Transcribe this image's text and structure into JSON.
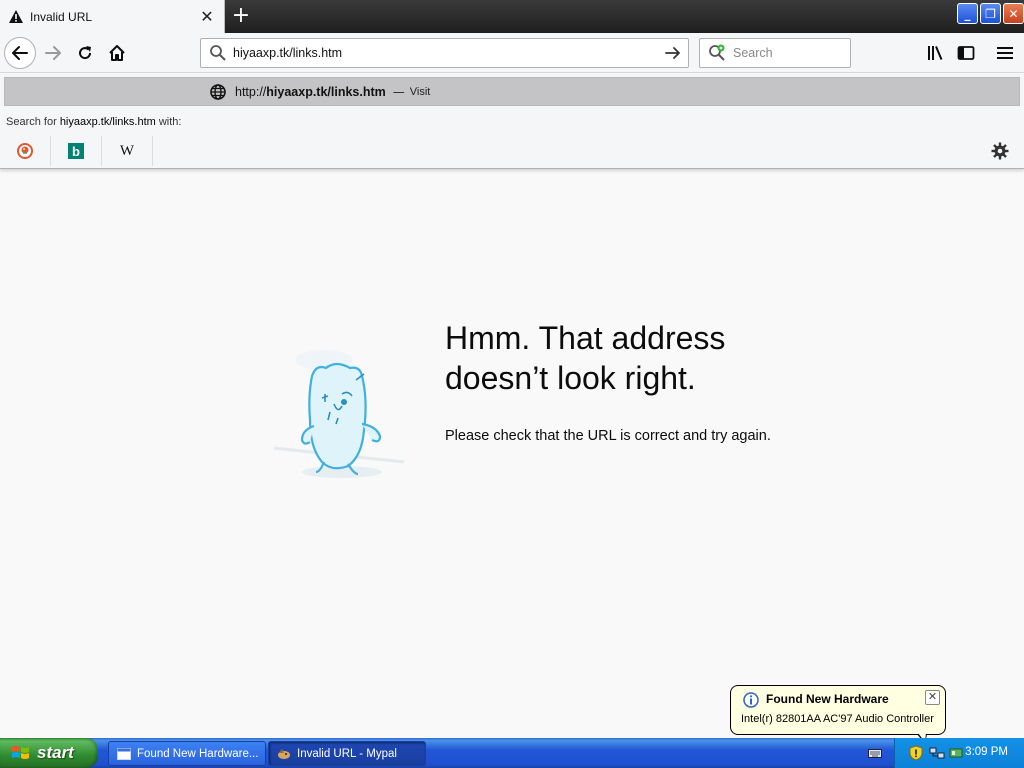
{
  "browser": {
    "tab": {
      "title": "Invalid URL",
      "close_glyph": "✕",
      "icon": "warning-icon"
    },
    "new_tab_glyph": "+",
    "window_controls": {
      "minimize": "_",
      "restore": "❐",
      "close": "✕"
    },
    "url_input": {
      "value": "hiyaaxp.tk/links.htm"
    },
    "search_input": {
      "placeholder": "Search"
    }
  },
  "dropdown": {
    "suggestion": {
      "prefix": "http://",
      "host": "hiyaaxp.tk/links.htm",
      "dash": "—",
      "action": "Visit"
    },
    "search_for": {
      "before": "Search for ",
      "term": "hiyaaxp.tk/links.htm",
      "after": " with:"
    },
    "engines": [
      {
        "name": "DuckDuckGo",
        "icon": "duckduckgo-icon"
      },
      {
        "name": "Bing",
        "icon": "bing-icon",
        "glyph": "b"
      },
      {
        "name": "Wikipedia",
        "icon": "wikipedia-icon",
        "glyph": "W"
      }
    ]
  },
  "error_page": {
    "title_line1": "Hmm. That address",
    "title_line2": "doesn’t look right.",
    "description": "Please check that the URL is correct and try again."
  },
  "notification": {
    "title": "Found New Hardware",
    "text": "Intel(r) 82801AA AC'97 Audio Controller",
    "close_glyph": "✕"
  },
  "taskbar": {
    "start_label": "start",
    "items": [
      {
        "label": "Found New Hardware..."
      },
      {
        "label": "Invalid URL - Mypal"
      }
    ],
    "clock": "3:09 PM"
  },
  "colors": {
    "page_bg": "#f9f9fa",
    "mascot": "#7fd3f0",
    "taskbar": "#2157d7",
    "start_button": "#2f8a2f"
  }
}
